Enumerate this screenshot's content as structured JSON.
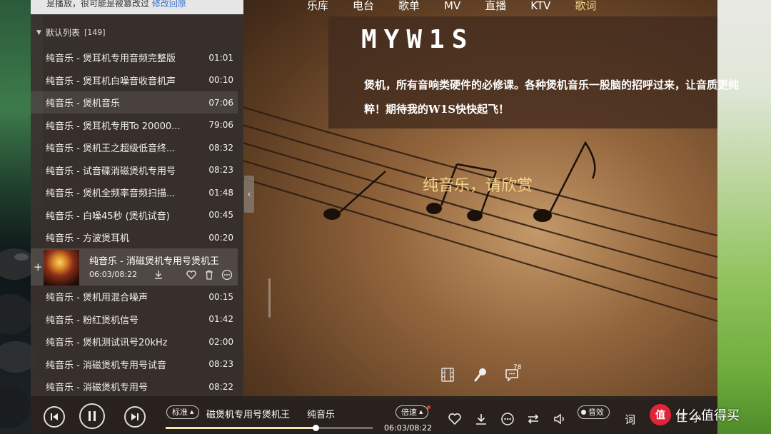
{
  "top_nav": {
    "items": [
      {
        "label": "乐库"
      },
      {
        "label": "电台"
      },
      {
        "label": "歌单"
      },
      {
        "label": "MV"
      },
      {
        "label": "直播"
      },
      {
        "label": "KTV"
      },
      {
        "label": "歌词"
      }
    ],
    "active_index": 6
  },
  "panel": {
    "top_strip_text": "是播放，很可能是被篡改过",
    "top_strip_link": "修改回原",
    "playlist_name": "默认列表",
    "playlist_count": "[149]"
  },
  "tracks": [
    {
      "title": "纯音乐 - 煲耳机专用音频完整版",
      "duration": "01:01"
    },
    {
      "title": "纯音乐 - 煲耳机白噪音收音机声",
      "duration": "00:10"
    },
    {
      "title": "纯音乐 - 煲机音乐",
      "duration": "07:06"
    },
    {
      "title": "纯音乐 - 煲耳机专用To 20000...",
      "duration": "79:06"
    },
    {
      "title": "纯音乐 - 煲机王之超级低音终...",
      "duration": "08:32"
    },
    {
      "title": "纯音乐 - 试音碟消磁煲机专用号",
      "duration": "08:23"
    },
    {
      "title": "纯音乐 - 煲机全频率音频扫描...",
      "duration": "01:48"
    },
    {
      "title": "纯音乐 - 白噪45秒 (煲机试音)",
      "duration": "00:45"
    },
    {
      "title": "纯音乐 - 方波煲耳机",
      "duration": "00:20"
    },
    {
      "title": "纯音乐 - 煲机用混合噪声",
      "duration": "00:15"
    },
    {
      "title": "纯音乐 - 粉红煲机信号",
      "duration": "01:42"
    },
    {
      "title": "纯音乐 - 煲机测试讯号20kHz",
      "duration": "02:00"
    },
    {
      "title": "纯音乐 - 消磁煲机专用号试音",
      "duration": "08:23"
    },
    {
      "title": "纯音乐 - 消磁煲机专用号",
      "duration": "08:22"
    }
  ],
  "now_playing": {
    "title": "纯音乐 - 消磁煲机专用号煲机王",
    "time": "06:03/08:22",
    "progress_fraction": 0.725
  },
  "info_card": {
    "title": "MYW1S",
    "description": "煲机，所有音响类硬件的必修课。各种煲机音乐一股脑的招呼过来，让音质更纯粹！期待我的W1S快快起飞！"
  },
  "lyric": "纯音乐，请欣赏",
  "floating": {
    "comment_count": "78",
    "icons": [
      "film-icon",
      "microphone-icon",
      "comment-icon"
    ]
  },
  "bottom_bar": {
    "quality_label": "标准",
    "song_title": "磁煲机专用号煲机王",
    "artist": "纯音乐",
    "speed_label": "倍速",
    "time": "06:03/08:22",
    "sound_effect_label": "音效",
    "lyric_label": "词",
    "extra_text": "生 小"
  },
  "watermark": {
    "logo_char": "值",
    "text": "什么值得买"
  },
  "colors": {
    "accent_gold": "#f3d38a",
    "active_nav": "#f3d78a",
    "link_blue": "#3a73c9",
    "watermark_red": "#e0243a"
  }
}
